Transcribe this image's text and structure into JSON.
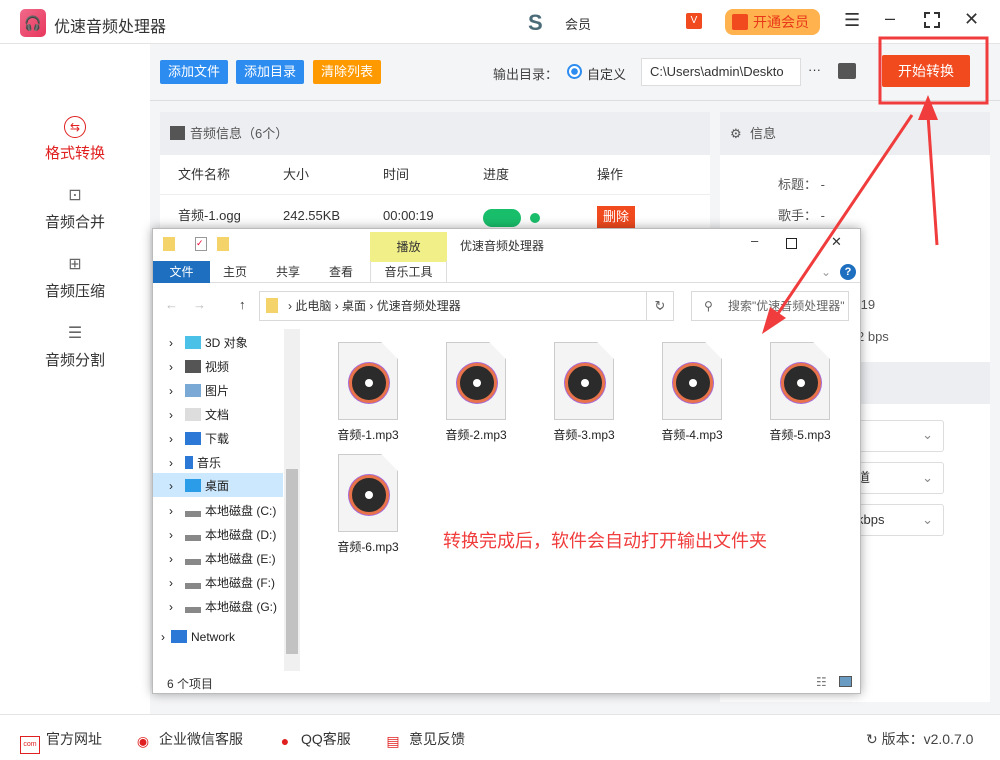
{
  "app": {
    "title": "优速音频处理器",
    "user_label": "会员",
    "vip_button": "开通会员",
    "version_label": "版本：",
    "version": "v2.0.7.0"
  },
  "sidebar": {
    "items": [
      {
        "label": "格式转换",
        "icon": "convert-icon",
        "active": true
      },
      {
        "label": "音频合并",
        "icon": "merge-icon"
      },
      {
        "label": "音频压缩",
        "icon": "compress-icon"
      },
      {
        "label": "音频分割",
        "icon": "split-icon"
      }
    ]
  },
  "toolbar": {
    "add_file": "添加文件",
    "add_dir": "添加目录",
    "clear_list": "清除列表",
    "output_label": "输出目录：",
    "radio_custom": "自定义",
    "output_path": "C:\\Users\\admin\\Deskto",
    "more": "···",
    "start": "开始转换"
  },
  "audio_panel": {
    "title": "音频信息（6个）",
    "columns": [
      "文件名称",
      "大小",
      "时间",
      "进度",
      "操作"
    ],
    "rows": [
      {
        "name": "音频-1.ogg",
        "size": "242.55KB",
        "time": "00:00:19",
        "progress": 100,
        "action": "删除"
      }
    ]
  },
  "info_panel": {
    "title": "信息",
    "fields": [
      {
        "label": "标题：",
        "value": "-"
      },
      {
        "label": "歌手：",
        "value": "-"
      }
    ],
    "partial_values": [
      ":19",
      "2 bps"
    ],
    "selects": [
      "",
      "道",
      "kbps"
    ]
  },
  "explorer": {
    "title": "优速音频处理器",
    "ribbon_context": "播放",
    "tabs": [
      "文件",
      "主页",
      "共享",
      "查看",
      "音乐工具"
    ],
    "breadcrumb": [
      "此电脑",
      "桌面",
      "优速音频处理器"
    ],
    "search_placeholder": "搜索\"优速音频处理器\"",
    "tree": [
      {
        "label": "3D 对象"
      },
      {
        "label": "视频"
      },
      {
        "label": "图片"
      },
      {
        "label": "文档"
      },
      {
        "label": "下载"
      },
      {
        "label": "音乐"
      },
      {
        "label": "桌面",
        "selected": true
      },
      {
        "label": "本地磁盘 (C:)"
      },
      {
        "label": "本地磁盘 (D:)"
      },
      {
        "label": "本地磁盘 (E:)"
      },
      {
        "label": "本地磁盘 (F:)"
      },
      {
        "label": "本地磁盘 (G:)"
      },
      {
        "label": "Network"
      }
    ],
    "files": [
      "音频-1.mp3",
      "音频-2.mp3",
      "音频-3.mp3",
      "音频-4.mp3",
      "音频-5.mp3",
      "音频-6.mp3"
    ],
    "status": "6 个项目"
  },
  "annotation": "转换完成后，软件会自动打开输出文件夹",
  "footer": {
    "links": [
      "官方网址",
      "企业微信客服",
      "QQ客服",
      "意见反馈"
    ]
  },
  "colors": {
    "accent_red": "#f04a1e",
    "blue_button": "#2d8cf0",
    "orange_button": "#ff9900",
    "arrow": "#f03c3c"
  }
}
